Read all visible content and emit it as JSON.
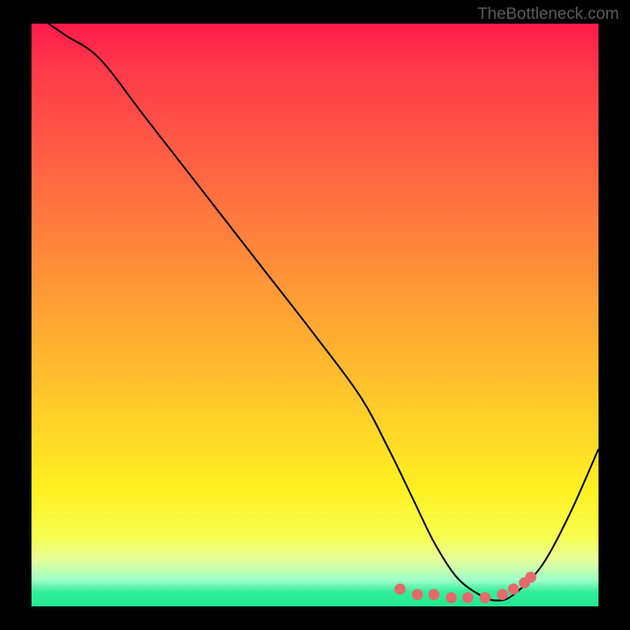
{
  "watermark": "TheBottleneck.com",
  "chart_data": {
    "type": "line",
    "title": "",
    "xlabel": "",
    "ylabel": "",
    "xlim": [
      0,
      100
    ],
    "ylim": [
      0,
      100
    ],
    "series": [
      {
        "name": "bottleneck-curve",
        "x": [
          0,
          3,
          6,
          12,
          20,
          30,
          40,
          50,
          58,
          63,
          67,
          71,
          75,
          79,
          82,
          85,
          90,
          95,
          100
        ],
        "values": [
          102,
          100,
          98,
          94,
          84,
          71.5,
          59,
          46.5,
          36,
          27,
          19,
          11,
          5,
          2,
          1,
          2,
          7,
          16,
          27
        ]
      }
    ],
    "markers": {
      "name": "highlight-range",
      "x": [
        65,
        68,
        71,
        74,
        77,
        80,
        83,
        85,
        87,
        88
      ],
      "values": [
        3,
        2,
        2,
        1.5,
        1.5,
        1.5,
        2,
        3,
        4,
        5
      ]
    },
    "background_gradient": {
      "top": "#ff1a4a",
      "mid": "#ffe028",
      "bottom": "#22e890"
    }
  }
}
